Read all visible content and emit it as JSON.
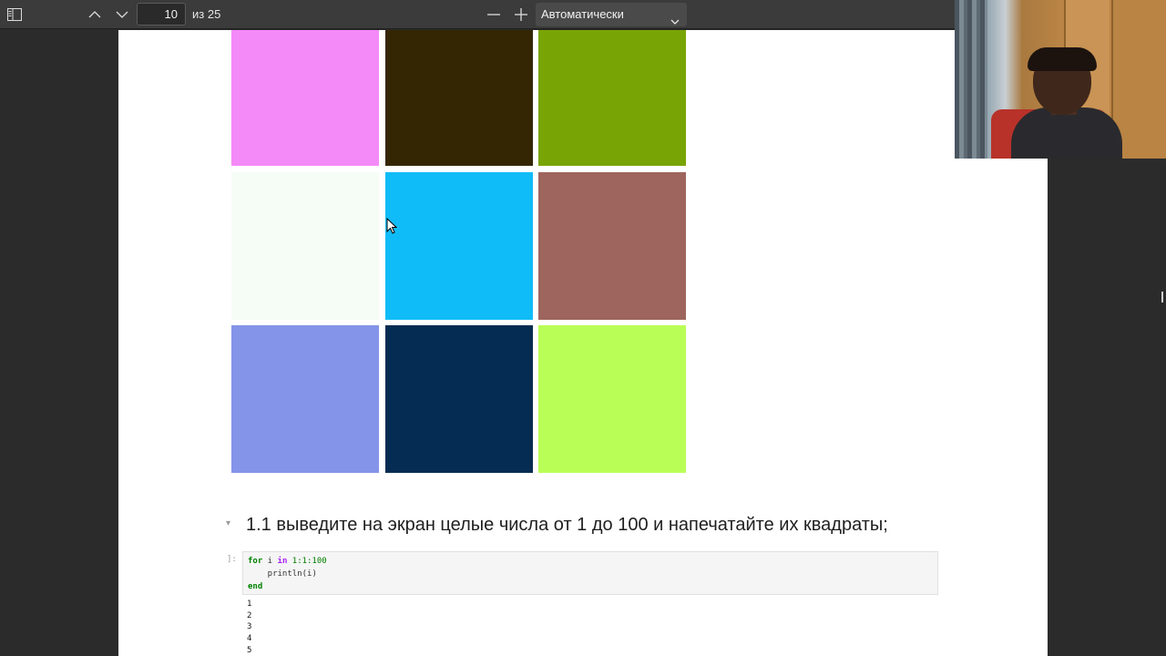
{
  "toolbar": {
    "current_page": "10",
    "page_total": "из 25",
    "zoom_mode": "Автоматически",
    "icons": [
      "sidebar-toggle-icon",
      "previous-page-icon",
      "next-page-icon",
      "zoom-out-icon",
      "zoom-in-icon",
      "chevron-down-icon"
    ]
  },
  "colors": {
    "grid": [
      "#f48af8",
      "#352603",
      "#79a405",
      "#f5fdf6",
      "#10bcf7",
      "#9e655e",
      "#8494e8",
      "#052c52",
      "#b9fe56"
    ]
  },
  "notebook": {
    "collapse_marker": "▾",
    "heading": "1.1 выведите на экран целые числа от 1 до 100 и напечатайте их квадраты;",
    "prompt": "]:",
    "code": {
      "l1_for": "for",
      "l1_var": " i ",
      "l1_in": "in",
      "l1_range": " 1:1:100",
      "l2": "    println(i)",
      "l3_end": "end"
    },
    "output": [
      "1",
      "2",
      "3",
      "4",
      "5"
    ]
  }
}
